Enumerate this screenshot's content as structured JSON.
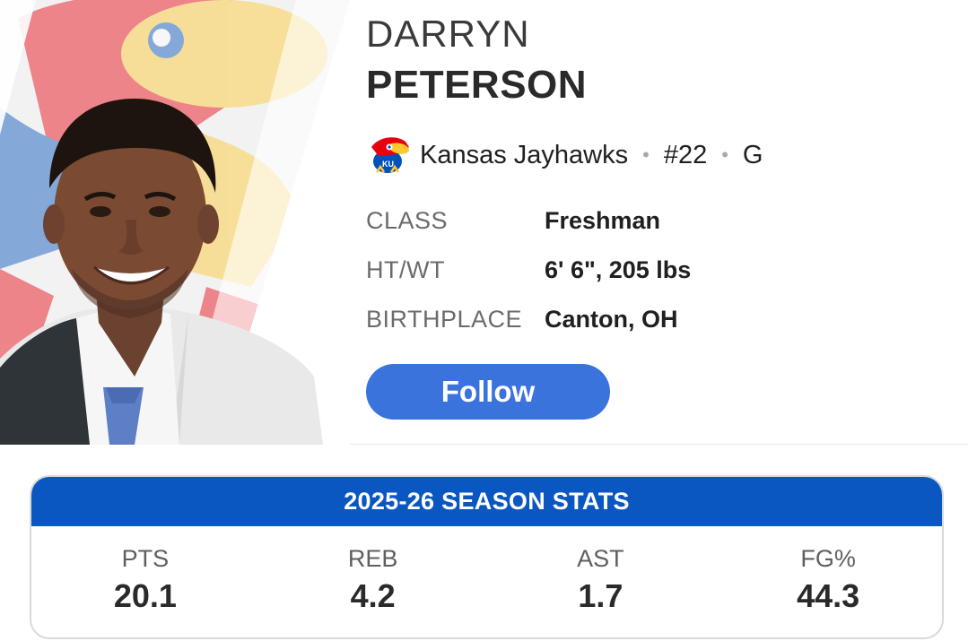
{
  "player": {
    "first_name": "DARRYN",
    "last_name": "PETERSON",
    "team": "Kansas Jayhawks",
    "number": "#22",
    "position": "G",
    "separator": "•",
    "photo_icon": "player-headshot",
    "team_logo_icon": "jayhawk-logo-icon"
  },
  "bio": [
    {
      "label": "CLASS",
      "value": "Freshman"
    },
    {
      "label": "HT/WT",
      "value": "6' 6\", 205 lbs"
    },
    {
      "label": "BIRTHPLACE",
      "value": "Canton, OH"
    }
  ],
  "follow_button": {
    "label": "Follow"
  },
  "stats": {
    "title": "2025-26 SEASON STATS",
    "items": [
      {
        "label": "PTS",
        "value": "20.1"
      },
      {
        "label": "REB",
        "value": "4.2"
      },
      {
        "label": "AST",
        "value": "1.7"
      },
      {
        "label": "FG%",
        "value": "44.3"
      }
    ]
  },
  "colors": {
    "follow_button": "#3b73dd",
    "stats_header": "#0b57c2",
    "jayhawks_red": "#e8000d",
    "jayhawks_blue": "#0051ba",
    "jayhawks_yellow": "#ffc82d"
  }
}
